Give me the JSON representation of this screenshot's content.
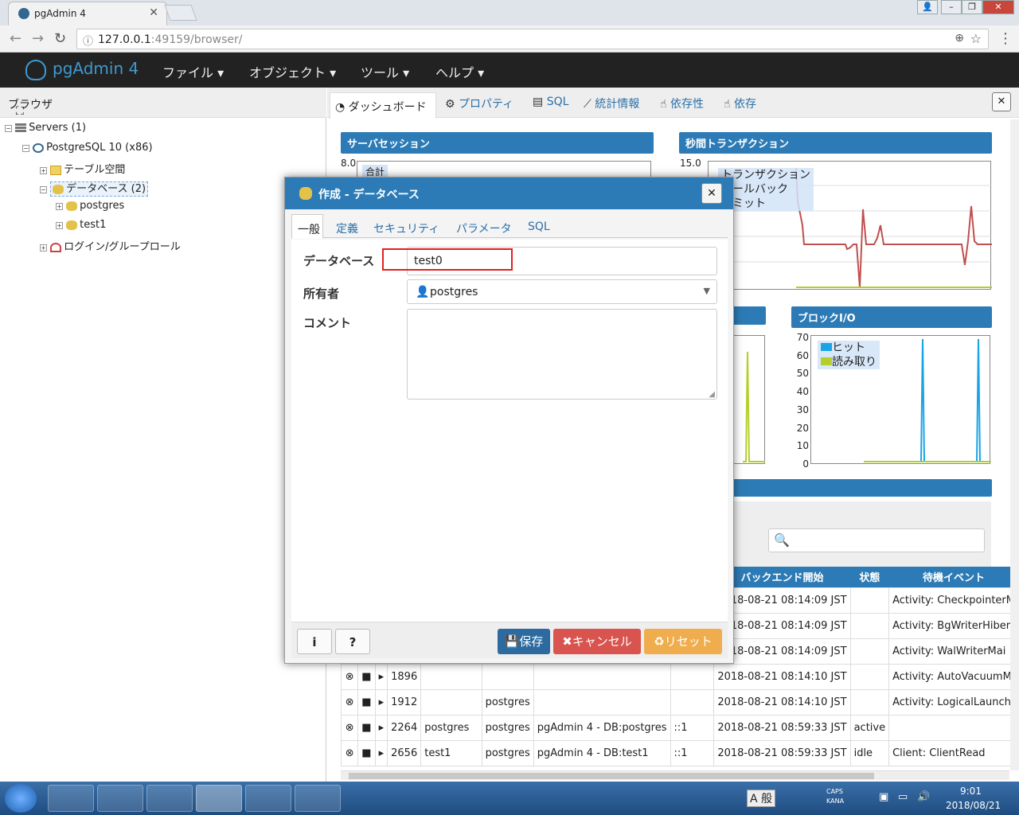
{
  "browser": {
    "tab_title": "pgAdmin 4",
    "url_host": "127.0.0.1",
    "url_rest": ":49159/browser/"
  },
  "navbar": {
    "brand": "pgAdmin 4",
    "menus": [
      "ファイル ▾",
      "オブジェクト ▾",
      "ツール ▾",
      "ヘルプ ▾"
    ]
  },
  "browser_panel": {
    "title": "ブラウザ",
    "tree": [
      {
        "label": "Servers (1)",
        "level": 0
      },
      {
        "label": "PostgreSQL 10 (x86)",
        "level": 1
      },
      {
        "label": "テーブル空間",
        "level": 2
      },
      {
        "label": "データベース (2)",
        "level": 2
      },
      {
        "label": "postgres",
        "level": 3
      },
      {
        "label": "test1",
        "level": 3
      },
      {
        "label": "ログイン/グループロール",
        "level": 2
      }
    ]
  },
  "right_tabs": [
    "ダッシュボード",
    "プロパティ",
    "SQL",
    "統計情報",
    "依存性",
    "依存"
  ],
  "dashboard": {
    "server_sessions": {
      "title": "サーバセッション",
      "ymax": "8.0",
      "legend": [
        "合計"
      ]
    },
    "tps": {
      "title": "秒間トランザクション",
      "ymax": "15.0",
      "legend": [
        "トランザクション",
        "ロールバック",
        "コミット"
      ]
    },
    "block_io": {
      "title": "ブロックI/O",
      "y_ticks": [
        "70",
        "60",
        "50",
        "40",
        "30",
        "20",
        "10",
        "0"
      ],
      "legend": [
        "ヒット",
        "読み取り"
      ]
    },
    "activity_headers": [
      "バックエンド開始",
      "状態",
      "待機イベント"
    ],
    "rows": [
      {
        "pid": "",
        "db": "",
        "user": "",
        "app": "",
        "client": "",
        "start": "2018-08-21 08:14:09 JST",
        "state": "",
        "wait": "Activity: CheckpointerM"
      },
      {
        "pid": "",
        "db": "",
        "user": "",
        "app": "",
        "client": "",
        "start": "2018-08-21 08:14:09 JST",
        "state": "",
        "wait": "Activity: BgWriterHiber"
      },
      {
        "pid": "",
        "db": "",
        "user": "",
        "app": "",
        "client": "",
        "start": "2018-08-21 08:14:09 JST",
        "state": "",
        "wait": "Activity: WalWriterMai"
      },
      {
        "pid": "1896",
        "db": "",
        "user": "",
        "app": "",
        "client": "",
        "start": "2018-08-21 08:14:10 JST",
        "state": "",
        "wait": "Activity: AutoVacuumM"
      },
      {
        "pid": "1912",
        "db": "",
        "user": "postgres",
        "app": "",
        "client": "",
        "start": "2018-08-21 08:14:10 JST",
        "state": "",
        "wait": "Activity: LogicalLaunch"
      },
      {
        "pid": "2264",
        "db": "postgres",
        "user": "postgres",
        "app": "pgAdmin 4 - DB:postgres",
        "client": "::1",
        "start": "2018-08-21 08:59:33 JST",
        "state": "active",
        "wait": ""
      },
      {
        "pid": "2656",
        "db": "test1",
        "user": "postgres",
        "app": "pgAdmin 4 - DB:test1",
        "client": "::1",
        "start": "2018-08-21 08:59:33 JST",
        "state": "idle",
        "wait": "Client: ClientRead"
      }
    ]
  },
  "dialog": {
    "title": "作成 - データベース",
    "tabs": [
      "一般",
      "定義",
      "セキュリティ",
      "パラメータ",
      "SQL"
    ],
    "labels": {
      "database": "データベース",
      "owner": "所有者",
      "comment": "コメント"
    },
    "database_value": "test0",
    "owner_value": "postgres",
    "comment_value": "",
    "buttons": {
      "info": "i",
      "help": "?",
      "save": "保存",
      "cancel": "キャンセル",
      "reset": "リセット"
    }
  },
  "taskbar": {
    "ime": "A 般",
    "caps": "CAPS",
    "kana": "KANA",
    "time": "9:01",
    "date": "2018/08/21"
  },
  "colors": {
    "accent": "#2c7bb6",
    "save": "#2c6aa0",
    "cancel": "#d9534f",
    "reset": "#f0ad4e",
    "highlight": "#e02020"
  }
}
